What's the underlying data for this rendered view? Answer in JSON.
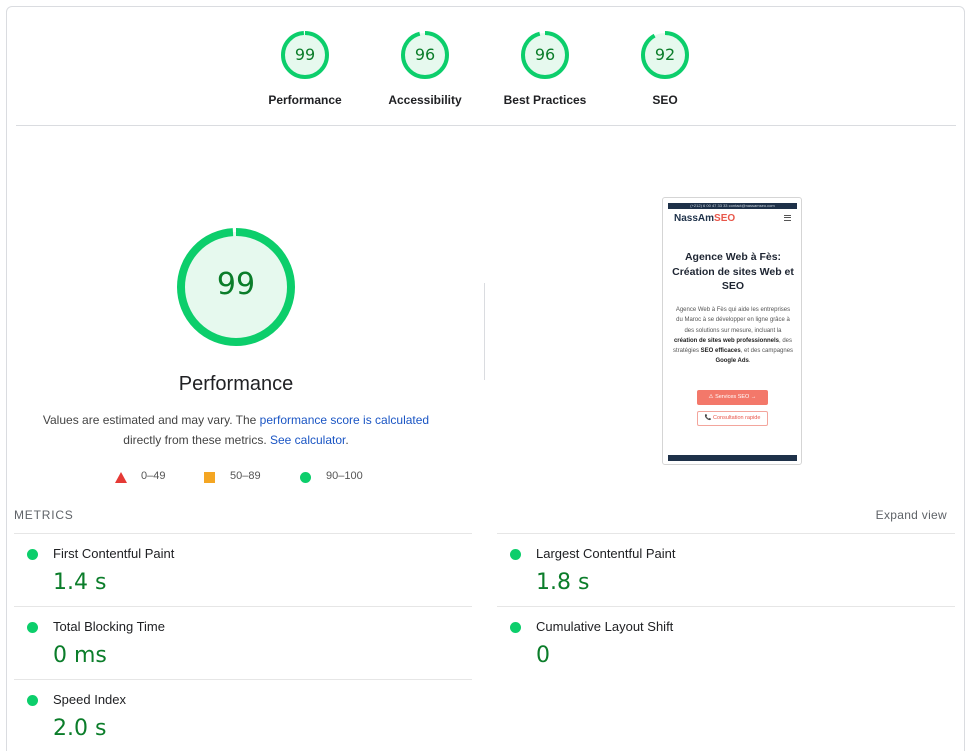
{
  "categories": [
    {
      "label": "Performance",
      "score": "99",
      "fraction": 0.99
    },
    {
      "label": "Accessibility",
      "score": "96",
      "fraction": 0.96
    },
    {
      "label": "Best Practices",
      "score": "96",
      "fraction": 0.96
    },
    {
      "label": "SEO",
      "score": "92",
      "fraction": 0.92
    }
  ],
  "performance": {
    "score": "99",
    "fraction": 0.99,
    "title": "Performance",
    "desc_prefix": "Values are estimated and may vary. The ",
    "desc_link1": "performance score is calculated",
    "desc_middle": " directly from these metrics. ",
    "desc_link2": "See calculator",
    "desc_suffix": "."
  },
  "legend": [
    {
      "range": "0–49",
      "shape": "triangle",
      "color": "#e53935"
    },
    {
      "range": "50–89",
      "shape": "square",
      "color": "#f4a623"
    },
    {
      "range": "90–100",
      "shape": "circle",
      "color": "#0cce6b"
    }
  ],
  "screenshot": {
    "topbar": "(+212) 6 00 47 33 33     contact@nassamseo.com",
    "logo_main": "NassAm",
    "logo_accent": "SEO",
    "headline": "Agence Web à Fès: Création de sites Web et SEO",
    "body_1": "Agence Web à Fès qui aide les entreprises du Maroc à se développer en ligne grâce à des solutions sur mesure, incluant la ",
    "body_bold_1": "création de sites web professionnels",
    "body_2": ", des stratégies ",
    "body_bold_2": "SEO efficaces",
    "body_3": ", et des campagnes ",
    "body_bold_3": "Google Ads",
    "body_4": ".",
    "button_primary": "⚠ Services SEO →",
    "button_secondary": "📞 Consultation rapide"
  },
  "metrics": {
    "heading": "METRICS",
    "expand_label": "Expand view",
    "items": [
      {
        "name": "First Contentful Paint",
        "value": "1.4 s"
      },
      {
        "name": "Largest Contentful Paint",
        "value": "1.8 s"
      },
      {
        "name": "Total Blocking Time",
        "value": "0 ms"
      },
      {
        "name": "Cumulative Layout Shift",
        "value": "0"
      },
      {
        "name": "Speed Index",
        "value": "2.0 s"
      }
    ]
  },
  "colors": {
    "pass": "#0cce6b",
    "pass_text": "#0b7d2a",
    "pass_fill": "#e6f9ee",
    "link": "#1a55c4"
  }
}
